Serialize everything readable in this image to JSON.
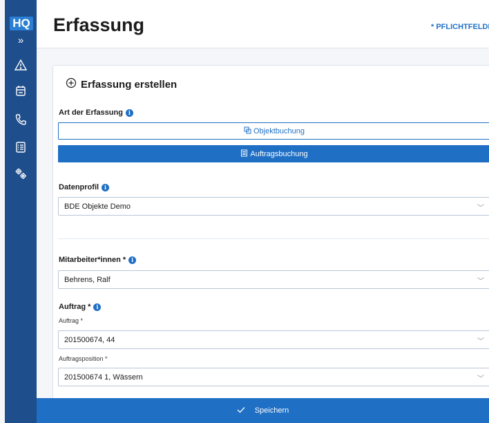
{
  "sidebar": {
    "logo": "HQ",
    "expand_glyph": "»",
    "items": [
      {
        "icon": "warning-triangle-icon"
      },
      {
        "icon": "calendar-icon"
      },
      {
        "icon": "phone-icon"
      },
      {
        "icon": "checklist-icon"
      },
      {
        "icon": "settings-gears-icon"
      }
    ]
  },
  "header": {
    "title": "Erfassung",
    "required_note": "* PFLICHTFELDER"
  },
  "form": {
    "title": "Erfassung erstellen",
    "art_label": "Art der Erfassung",
    "objekt_button": "Objektbuchung",
    "auftrag_button": "Auftragsbuchung",
    "datenprofil_label": "Datenprofil",
    "datenprofil_value": "BDE Objekte Demo",
    "mitarbeiter_label": "Mitarbeiter*innen *",
    "mitarbeiter_value": "Behrens, Ralf",
    "auftrag_section_label": "Auftrag *",
    "auftrag_label": "Auftrag *",
    "auftrag_value": "201500674, 44",
    "position_label": "Auftragsposition *",
    "position_value": "201500674 1, Wässern"
  },
  "footer": {
    "save_label": "Speichern"
  },
  "colors": {
    "sidebar": "#1f4e8c",
    "accent": "#1f6fc5",
    "logo_bg": "#2a7fd4"
  }
}
